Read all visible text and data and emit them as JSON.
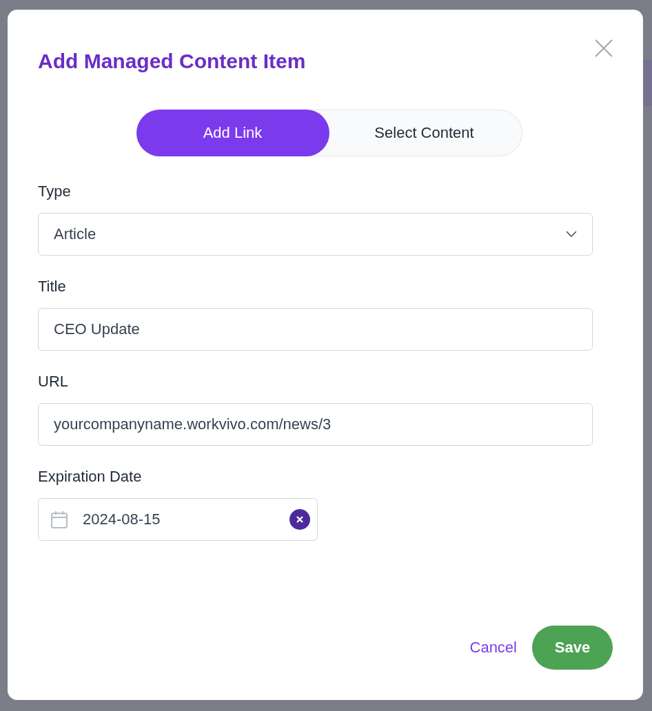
{
  "dialog": {
    "title": "Add Managed Content Item"
  },
  "tabs": [
    {
      "label": "Add Link",
      "selected": true
    },
    {
      "label": "Select Content",
      "selected": false
    }
  ],
  "fields": [
    {
      "kind": "select",
      "label": "Type",
      "value": "Article"
    },
    {
      "kind": "text",
      "label": "Title",
      "value": "CEO Update"
    },
    {
      "kind": "text",
      "label": "URL",
      "value": "yourcompanyname.workvivo.com/news/3"
    },
    {
      "kind": "date",
      "label": "Expiration Date",
      "value": "2024-08-15"
    }
  ],
  "buttons": [
    {
      "kind": "link",
      "label": "Cancel"
    },
    {
      "kind": "primary",
      "label": "Save"
    }
  ]
}
